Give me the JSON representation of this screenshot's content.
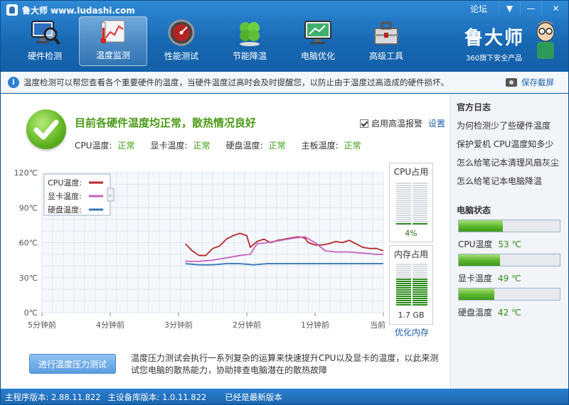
{
  "app": {
    "title": "鲁大师 www.ludashi.com",
    "forum": "论坛"
  },
  "window_controls": {
    "menu": "▼",
    "minimize": "—",
    "close": "✕"
  },
  "toolbar": [
    {
      "label": "硬件检测",
      "icon": "monitor-magnifier-icon"
    },
    {
      "label": "温度监测",
      "icon": "thermometer-chart-icon",
      "active": true
    },
    {
      "label": "性能测试",
      "icon": "speedometer-icon"
    },
    {
      "label": "节能降温",
      "icon": "clover-leaf-icon"
    },
    {
      "label": "电脑优化",
      "icon": "monitor-optimize-icon"
    },
    {
      "label": "高级工具",
      "icon": "toolbox-icon"
    }
  ],
  "brand": {
    "name": "鲁大师",
    "sub": "360旗下安全产品"
  },
  "infobar": {
    "text": "温度检测可以帮您查看各个重要硬件的温度，当硬件温度过高时会及时提醒您，以防止由于温度过高造成的硬件损坏。",
    "save": "保存截屏"
  },
  "status": {
    "title": "目前各硬件温度均正常，散热情况良好",
    "items": [
      {
        "label": "CPU温度:",
        "value": "正常"
      },
      {
        "label": "显卡温度:",
        "value": "正常"
      },
      {
        "label": "硬盘温度:",
        "value": "正常"
      },
      {
        "label": "主板温度:",
        "value": "正常"
      }
    ],
    "alarm_label": "启用高温报警",
    "settings": "设置"
  },
  "chart_data": {
    "type": "line",
    "x_tick_labels": [
      "5分钟前",
      "4分钟前",
      "3分钟前",
      "2分钟前",
      "1分钟前",
      "当前"
    ],
    "y_tick_labels": [
      "0℃",
      "30℃",
      "60℃",
      "90℃",
      "120℃"
    ],
    "ylim": [
      0,
      120
    ],
    "xlim": [
      -5,
      0
    ],
    "grid": true,
    "legend": "top-left",
    "series": [
      {
        "name": "CPU温度:",
        "color": "#b62a2a",
        "x": [
          -2.9,
          -2.8,
          -2.7,
          -2.6,
          -2.5,
          -2.4,
          -2.3,
          -2.2,
          -2.1,
          -2.0,
          -1.95,
          -1.85,
          -1.75,
          -1.65,
          -1.55,
          -1.45,
          -1.35,
          -1.25,
          -1.15,
          -1.1,
          -1.0,
          -0.9,
          -0.8,
          -0.7,
          -0.6,
          -0.5,
          -0.4,
          -0.3,
          -0.2,
          -0.1,
          0.0
        ],
        "y": [
          59,
          53,
          49,
          49,
          55,
          57,
          63,
          66,
          68,
          66,
          56,
          61,
          63,
          60,
          62,
          63,
          64,
          65,
          64,
          60,
          58,
          58,
          59,
          61,
          60,
          62,
          59,
          56,
          55,
          55,
          53
        ]
      },
      {
        "name": "显卡温度:",
        "color": "#c85fc0",
        "x": [
          -2.9,
          -2.7,
          -2.5,
          -2.3,
          -2.1,
          -1.95,
          -1.85,
          -1.7,
          -1.5,
          -1.3,
          -1.15,
          -1.0,
          -0.85,
          -0.7,
          -0.5,
          -0.3,
          -0.1,
          0.0
        ],
        "y": [
          44,
          44,
          45,
          47,
          49,
          50,
          59,
          60,
          62,
          64,
          65,
          60,
          53,
          52,
          52,
          51,
          50,
          50
        ]
      },
      {
        "name": "硬盘温度:",
        "color": "#3c78b8",
        "x": [
          -2.9,
          -2.7,
          -2.5,
          -2.3,
          -2.1,
          -1.9,
          -1.7,
          -1.5,
          -1.3,
          -1.1,
          -0.9,
          -0.7,
          -0.5,
          -0.3,
          -0.1,
          0.0
        ],
        "y": [
          42,
          41,
          41,
          42,
          42,
          41,
          42,
          42,
          42,
          42,
          42,
          42,
          42,
          42,
          42,
          42
        ]
      }
    ]
  },
  "cpu_usage": {
    "title": "CPU占用",
    "value": "4%",
    "fraction": 0.04
  },
  "mem_usage": {
    "title": "内存占用",
    "value": "1.7 GB",
    "fraction": 0.6,
    "optimize": "优化内存"
  },
  "stress": {
    "button": "进行温度压力测试",
    "desc": "温度压力测试会执行一系列复杂的运算来快速提升CPU以及显卡的温度，以此来测试您电脑的散热能力，协助排查电脑潜在的散热故障"
  },
  "side": {
    "log_title": "官方日志",
    "links": [
      "为何检测少了些硬件温度",
      "保护爱机 CPU温度知多少",
      "怎么给笔记本清理风扇灰尘",
      "怎么给笔记本电脑降温"
    ],
    "pc_title": "电脑状态",
    "temps": [
      {
        "label": "CPU温度",
        "value": "53 ℃",
        "fraction": 0.44
      },
      {
        "label": "显卡温度",
        "value": "49 ℃",
        "fraction": 0.41
      },
      {
        "label": "硬盘温度",
        "value": "42 ℃",
        "fraction": 0.35
      }
    ]
  },
  "statusbar": {
    "main_ver": "主程序版本: 2.88.11.822",
    "db_ver": "主设备库版本: 1.0.11.822",
    "latest": "已经是最新版本"
  }
}
